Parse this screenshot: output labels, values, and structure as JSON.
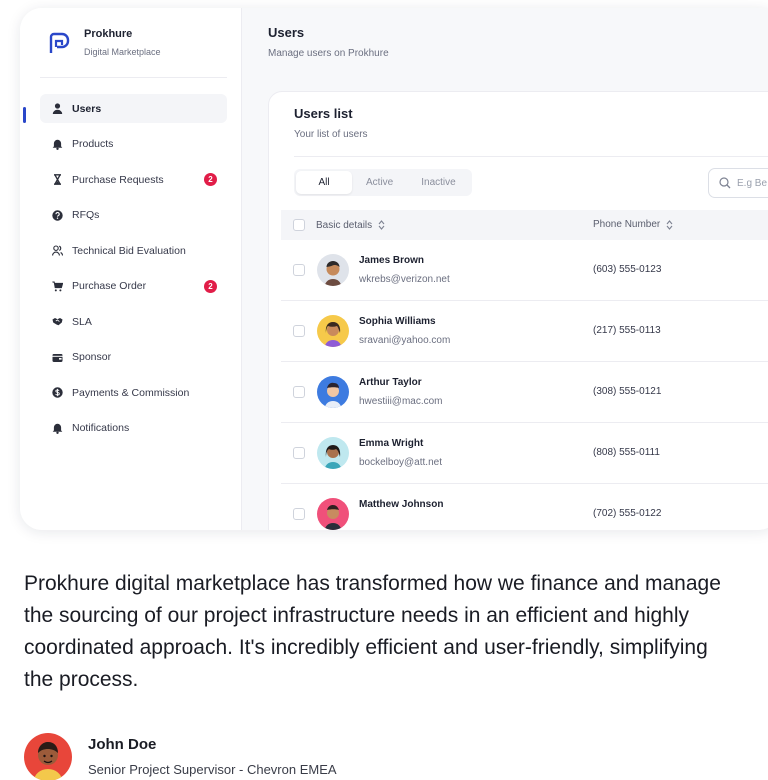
{
  "brand": {
    "name": "Prokhure",
    "subtitle": "Digital Marketplace",
    "accent_color": "#2a47c9"
  },
  "sidebar": {
    "items": [
      {
        "label": "Users",
        "icon": "user-icon",
        "active": true
      },
      {
        "label": "Products",
        "icon": "bell-icon"
      },
      {
        "label": "Purchase Requests",
        "icon": "hourglass-icon",
        "badge": "2"
      },
      {
        "label": "RFQs",
        "icon": "question-icon"
      },
      {
        "label": "Technical Bid Evaluation",
        "icon": "users-icon"
      },
      {
        "label": "Purchase Order",
        "icon": "cart-icon",
        "badge": "2"
      },
      {
        "label": "SLA",
        "icon": "handshake-icon"
      },
      {
        "label": "Sponsor",
        "icon": "wallet-icon"
      },
      {
        "label": "Payments & Commission",
        "icon": "dollar-icon"
      },
      {
        "label": "Notifications",
        "icon": "bell-icon"
      }
    ],
    "badge_color": "#e11d48"
  },
  "header": {
    "title": "Users",
    "subtitle": "Manage users on Prokhure"
  },
  "panel": {
    "title": "Users list",
    "subtitle": "Your list of users",
    "tabs": [
      {
        "label": "All",
        "active": true
      },
      {
        "label": "Active"
      },
      {
        "label": "Inactive"
      }
    ],
    "search_placeholder": "E.g Be"
  },
  "table": {
    "columns": [
      "Basic details",
      "Phone Number"
    ],
    "rows": [
      {
        "name": "James Brown",
        "email": "wkrebs@verizon.net",
        "phone": "(603) 555-0123"
      },
      {
        "name": "Sophia Williams",
        "email": "sravani@yahoo.com",
        "phone": "(217) 555-0113"
      },
      {
        "name": "Arthur Taylor",
        "email": "hwestiii@mac.com",
        "phone": "(308) 555-0121"
      },
      {
        "name": "Emma Wright",
        "email": "bockelboy@att.net",
        "phone": "(808) 555-0111"
      },
      {
        "name": "Matthew Johnson",
        "email": "",
        "phone": "(702) 555-0122"
      }
    ]
  },
  "testimonial": {
    "quote": "Prokhure digital marketplace has transformed how we finance and manage the sourcing of our project infrastructure needs in an efficient and highly coordinated approach. It's incredibly efficient and user-friendly, simplifying the process.",
    "author_name": "John Doe",
    "author_role": "Senior Project Supervisor  - Chevron EMEA"
  }
}
